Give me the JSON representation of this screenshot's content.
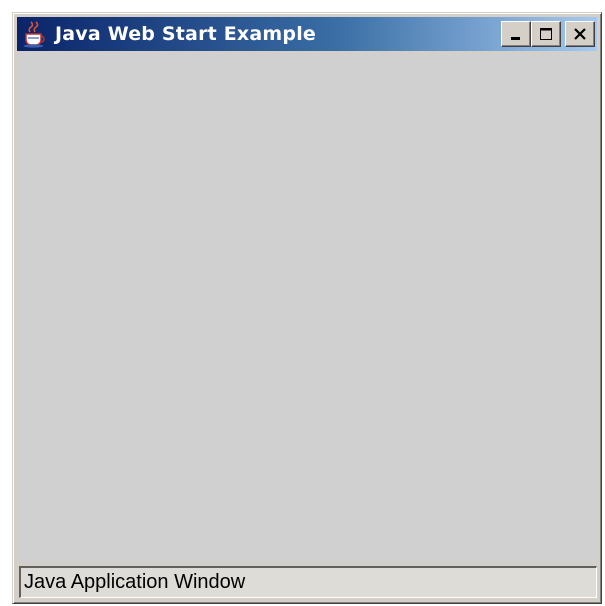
{
  "window": {
    "title": "Java Web Start Example",
    "icon": "java-cup-icon",
    "controls": {
      "minimize_icon": "minimize-icon",
      "maximize_icon": "maximize-icon",
      "close_icon": "close-icon"
    },
    "colors": {
      "titlebar_start": "#0a246a",
      "titlebar_end": "#a6caf0",
      "client_background": "#d0d0d0",
      "frame": "#d4d0c8"
    }
  },
  "statusbar": {
    "text": "Java Application Window"
  }
}
